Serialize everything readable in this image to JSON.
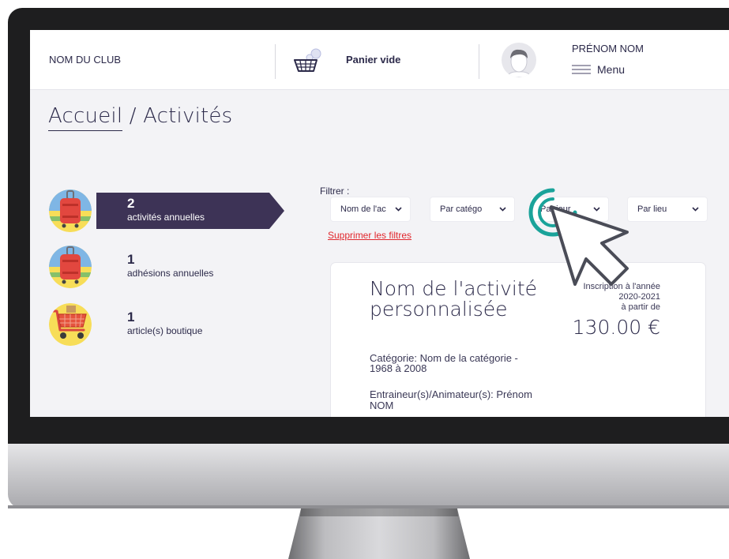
{
  "header": {
    "club_name": "NOM DU CLUB",
    "cart_label": "Panier vide",
    "user_name": "PRÉNOM NOM",
    "menu_label": "Menu"
  },
  "breadcrumb": {
    "home": "Accueil",
    "separator": " / ",
    "current": "Activités"
  },
  "stats": [
    {
      "count": "2",
      "label": "activités annuelles",
      "icon": "suitcase-icon",
      "active": true
    },
    {
      "count": "1",
      "label": "adhésions annuelles",
      "icon": "suitcase-icon",
      "active": false
    },
    {
      "count": "1",
      "label": "article(s) boutique",
      "icon": "shopping-cart-icon",
      "active": false
    }
  ],
  "filters": {
    "label": "Filtrer :",
    "selects": [
      {
        "value": "Nom de l'ac"
      },
      {
        "value": "Par catégo"
      },
      {
        "value": "Par jour"
      },
      {
        "value": "Par lieu"
      }
    ],
    "clear": "Supprimer les filtres"
  },
  "activity": {
    "title": "Nom de l'activité personnalisée",
    "category": "Catégorie: Nom de la catégorie - 1968 à 2008",
    "coach": "Entraineur(s)/Animateur(s): Prénom NOM",
    "price_caption_1": "Inscription à l'année",
    "price_caption_2": "2020-2021",
    "price_caption_3": "à partir de",
    "price": "130.00 €"
  },
  "colors": {
    "brand_dark": "#3d3356",
    "text": "#2c2a4a",
    "link_red": "#e1272d",
    "tap_teal": "#1aa39a"
  }
}
